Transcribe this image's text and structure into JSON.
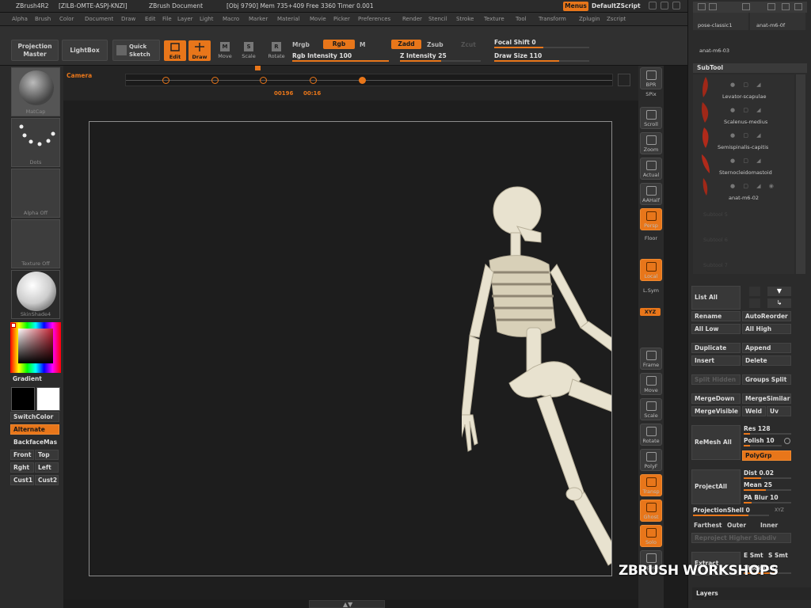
{
  "titlebar": {
    "app": "ZBrush4R2",
    "build": "[ZILB-OMTE-ASPJ-KNZI]",
    "doc": "ZBrush Document",
    "stats": "[Obj 9790] Mem 735+409 Free 3360 Timer 0.001",
    "menus_btn": "Menus",
    "script": "DefaultZScript"
  },
  "menubar": [
    "Alpha",
    "Brush",
    "Color",
    "Document",
    "Draw",
    "Edit",
    "File",
    "Layer",
    "Light",
    "Macro",
    "Marker",
    "Material",
    "Movie",
    "Picker",
    "Preferences",
    "Render",
    "Stencil",
    "Stroke",
    "Texture",
    "Tool",
    "Transform",
    "Zplugin",
    "Zscript"
  ],
  "toolbar": {
    "projection_master": "Projection Master",
    "lightbox": "LightBox",
    "quick_sketch": "Quick Sketch",
    "edit": "Edit",
    "draw": "Draw",
    "move": "Move",
    "scale": "Scale",
    "rotate": "Rotate",
    "mrgb": "Mrgb",
    "rgb": "Rgb",
    "m": "M",
    "rgb_intensity": "Rgb Intensity 100",
    "zadd": "Zadd",
    "zsub": "Zsub",
    "zcut": "Zcut",
    "z_intensity": "Z Intensity 25",
    "focal_shift": "Focal Shift 0",
    "draw_size": "Draw Size 110"
  },
  "timeline": {
    "camera": "Camera",
    "time_a": "00196",
    "time_b": "00:16"
  },
  "leftshelf": {
    "material": "MatCap",
    "stroke": "Dots",
    "alpha": "Alpha Off",
    "texture": "Texture Off",
    "material2": "SkinShade4",
    "gradient": "Gradient",
    "switch_color": "SwitchColor",
    "alternate": "Alternate",
    "backface": "BackfaceMas",
    "front": "Front",
    "top": "Top",
    "right": "Rght",
    "left": "Left",
    "cust1": "Cust1",
    "cust2": "Cust2"
  },
  "rightshelf": [
    "BPR",
    "SPix",
    "Scroll",
    "Zoom",
    "Actual",
    "AAHalf",
    "Persp",
    "Floor",
    "Local",
    "L.Sym",
    "XYZ",
    "Frame",
    "Move",
    "Scale",
    "Rotate",
    "PolyF",
    "Transp",
    "Ghost",
    "Solo",
    "Xpose"
  ],
  "panel": {
    "tool_thumb_1": "pose-classic1",
    "tool_thumb_2": "anat-m6-0f",
    "tool_thumb_3": "anat-m6-03",
    "subtool_header": "SubTool",
    "subtools": [
      "Levator-scapulae",
      "Scalenus-medius",
      "Semispinalis-capitis",
      "Sternocleidomastoid",
      "anat-m6-02"
    ],
    "empty_slots": [
      "Subtool 5",
      "Subtool 6",
      "Subtool 7"
    ],
    "list_all": "List All",
    "rename": "Rename",
    "auto_reorder": "AutoReorder",
    "all_low": "All Low",
    "all_high": "All High",
    "duplicate": "Duplicate",
    "append": "Append",
    "insert": "Insert",
    "delete": "Delete",
    "split_hidden": "Split Hidden",
    "groups_split": "Groups Split",
    "merge_down": "MergeDown",
    "merge_similar": "MergeSimilar",
    "merge_visible": "MergeVisible",
    "weld": "Weld",
    "uv": "Uv",
    "remesh_all": "ReMesh All",
    "res": "Res 128",
    "polish": "Polish 10",
    "polygrp": "PolyGrp",
    "project_all": "ProjectAll",
    "dist": "Dist 0.02",
    "mean": "Mean 25",
    "pa_blur": "PA Blur 10",
    "projection_shell": "ProjectionShell 0",
    "xyz": "XYZ",
    "farthest": "Farthest",
    "outer": "Outer",
    "inner": "Inner",
    "reproject": "Reproject Higher Subdiv",
    "extract": "Extract",
    "e_smt": "E Smt",
    "s_smt": "S Smt",
    "thick": "Thick 0.02",
    "layers": "Layers"
  },
  "watermark": "ZBRUSH WORKSHOPS",
  "colors": {
    "accent": "#e8761a",
    "bg": "#1e1e1e",
    "panel": "#2b2b2b"
  }
}
